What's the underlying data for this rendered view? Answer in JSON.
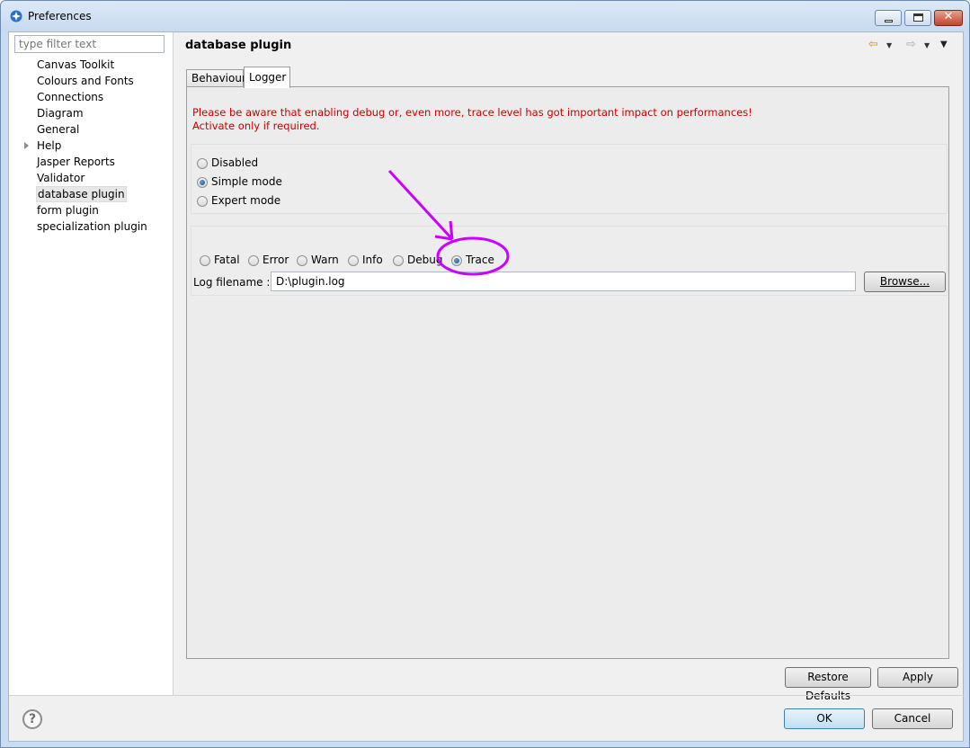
{
  "window": {
    "title": "Preferences",
    "accent_color": "#cc00ff"
  },
  "sidebar": {
    "filter_placeholder": "type filter text",
    "items": [
      {
        "label": "Canvas Toolkit"
      },
      {
        "label": "Colours and Fonts"
      },
      {
        "label": "Connections"
      },
      {
        "label": "Diagram"
      },
      {
        "label": "General"
      },
      {
        "label": "Help"
      },
      {
        "label": "Jasper Reports"
      },
      {
        "label": "Validator"
      },
      {
        "label": "database plugin"
      },
      {
        "label": "form plugin"
      },
      {
        "label": "specialization plugin"
      }
    ],
    "selected": "database plugin"
  },
  "page": {
    "title": "database plugin",
    "tabs": [
      {
        "label": "Behaviour",
        "active": false
      },
      {
        "label": "Logger",
        "active": true
      }
    ],
    "warning_line1": "Please be aware that enabling debug or, even more, trace level has got important impact on performances!",
    "warning_line2": "Activate only if required.",
    "warning_color": "#cc0000",
    "modes": [
      {
        "label": "Disabled",
        "checked": false
      },
      {
        "label": "Simple mode",
        "checked": true
      },
      {
        "label": "Expert mode",
        "checked": false
      }
    ],
    "levels": [
      {
        "label": "Fatal",
        "checked": false
      },
      {
        "label": "Error",
        "checked": false
      },
      {
        "label": "Warn",
        "checked": false
      },
      {
        "label": "Info",
        "checked": false
      },
      {
        "label": "Debug",
        "checked": false
      },
      {
        "label": "Trace",
        "checked": true
      }
    ],
    "log_filename_label": "Log filename :",
    "log_filename_value": "D:\\plugin.log",
    "browse_label": "Browse...",
    "restore_defaults_label": "Restore Defaults",
    "apply_label": "Apply"
  },
  "footer": {
    "ok_label": "OK",
    "cancel_label": "Cancel"
  },
  "icons": {
    "app": "preferences-app-icon",
    "back": "back-arrow-icon",
    "forward": "forward-arrow-icon",
    "view_menu": "view-menu-icon",
    "help": "help-icon",
    "tree_expander": "expand-triangle-icon"
  }
}
